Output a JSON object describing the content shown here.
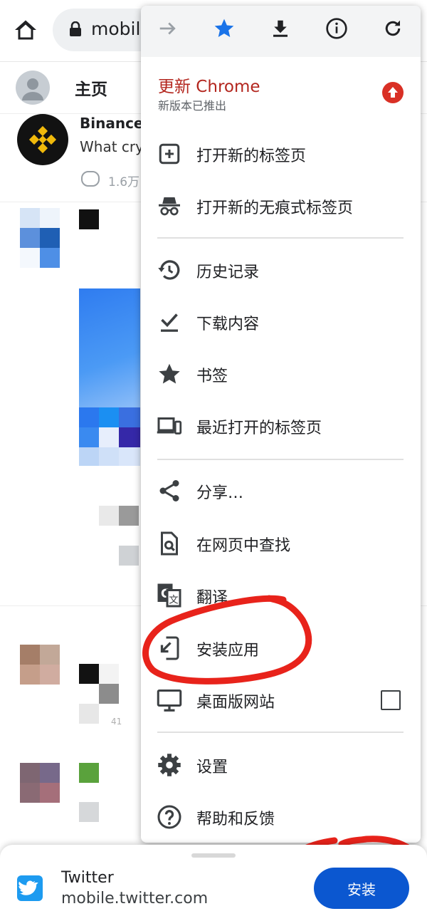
{
  "browser": {
    "url_text": "mobile",
    "icons": {
      "home": "home-icon",
      "lock": "lock-icon"
    }
  },
  "twitter": {
    "header_title": "主页",
    "tweet": {
      "author": "Binance",
      "text_preview": "What cry",
      "reply_count": "1.6万"
    },
    "tweet3_count": "41"
  },
  "menu": {
    "toolbar": [
      "forward-icon",
      "bookmark-star-icon",
      "download-icon",
      "page-info-icon",
      "reload-icon"
    ],
    "update": {
      "title": "更新 Chrome",
      "subtitle": "新版本已推出"
    },
    "items": [
      {
        "label": "打开新的标签页",
        "icon": "new-tab-icon"
      },
      {
        "label": "打开新的无痕式标签页",
        "icon": "incognito-icon"
      },
      {
        "label": "历史记录",
        "icon": "history-icon"
      },
      {
        "label": "下载内容",
        "icon": "downloads-icon"
      },
      {
        "label": "书签",
        "icon": "star-icon"
      },
      {
        "label": "最近打开的标签页",
        "icon": "devices-icon"
      },
      {
        "label": "分享…",
        "icon": "share-icon"
      },
      {
        "label": "在网页中查找",
        "icon": "find-in-page-icon"
      },
      {
        "label": "翻译…",
        "icon": "translate-icon"
      },
      {
        "label": "安装应用",
        "icon": "install-app-icon"
      },
      {
        "label": "桌面版网站",
        "icon": "desktop-icon"
      },
      {
        "label": "设置",
        "icon": "settings-icon"
      },
      {
        "label": "帮助和反馈",
        "icon": "help-icon"
      }
    ],
    "desktop_site_checked": false
  },
  "install_sheet": {
    "app_name": "Twitter",
    "app_url": "mobile.twitter.com",
    "install_label": "安装"
  },
  "colors": {
    "accent_blue": "#0b57d0",
    "update_red": "#b3261e",
    "annotation_red": "#e8231b",
    "twitter_blue": "#1d9bf0"
  }
}
